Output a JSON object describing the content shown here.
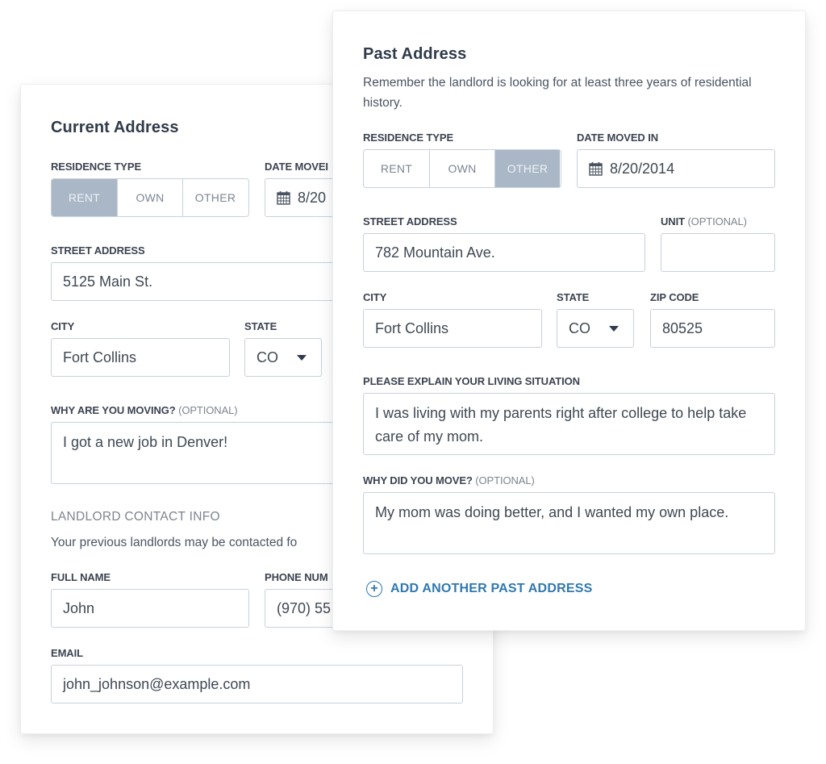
{
  "current_address": {
    "title": "Current Address",
    "residence_type": {
      "label": "RESIDENCE TYPE",
      "options": [
        "RENT",
        "OWN",
        "OTHER"
      ],
      "selected": "RENT"
    },
    "date_moved": {
      "label": "DATE MOVED IN",
      "label_visible": "DATE MOVEI",
      "value": "8/20"
    },
    "street_address": {
      "label": "STREET ADDRESS",
      "value": "5125 Main St."
    },
    "city": {
      "label": "CITY",
      "value": "Fort Collins"
    },
    "state": {
      "label": "STATE",
      "value": "CO"
    },
    "why_moving": {
      "label": "WHY ARE YOU MOVING?",
      "optional": "(OPTIONAL)",
      "value": "I got a new job in Denver!"
    },
    "landlord": {
      "heading": "LANDLORD CONTACT INFO",
      "description": "Your previous landlords may be contacted fo",
      "full_name": {
        "label": "FULL NAME",
        "value": "John"
      },
      "phone": {
        "label": "PHONE NUM",
        "value": "(970) 55"
      },
      "email": {
        "label": "EMAIL",
        "value": "john_johnson@example.com"
      }
    }
  },
  "past_address": {
    "title": "Past Address",
    "description": "Remember the landlord is looking for at least three years of residential history.",
    "residence_type": {
      "label": "RESIDENCE TYPE",
      "options": [
        "RENT",
        "OWN",
        "OTHER"
      ],
      "selected": "OTHER"
    },
    "date_moved": {
      "label": "DATE MOVED IN",
      "value": "8/20/2014"
    },
    "street_address": {
      "label": "STREET ADDRESS",
      "value": "782 Mountain Ave."
    },
    "unit": {
      "label": "UNIT",
      "optional": "(OPTIONAL)",
      "value": ""
    },
    "city": {
      "label": "CITY",
      "value": "Fort Collins"
    },
    "state": {
      "label": "STATE",
      "value": "CO"
    },
    "zip": {
      "label": "ZIP CODE",
      "value": "80525"
    },
    "living_situation": {
      "label": "PLEASE EXPLAIN YOUR LIVING SITUATION",
      "value": "I was living with my parents right after college to help take care of my  mom."
    },
    "why_moved": {
      "label": "WHY DID YOU MOVE?",
      "optional": "(OPTIONAL)",
      "value": "My mom was doing better, and I wanted my own place."
    },
    "add_another": "ADD ANOTHER PAST ADDRESS"
  },
  "colors": {
    "selected_segment": "#aab7c7",
    "link": "#2f78b0",
    "title": "#2f3b4a",
    "border": "#c9d1dc"
  },
  "icons": {
    "calendar": "calendar-icon",
    "dropdown": "chevron-down-icon",
    "add": "plus-circle-icon"
  }
}
